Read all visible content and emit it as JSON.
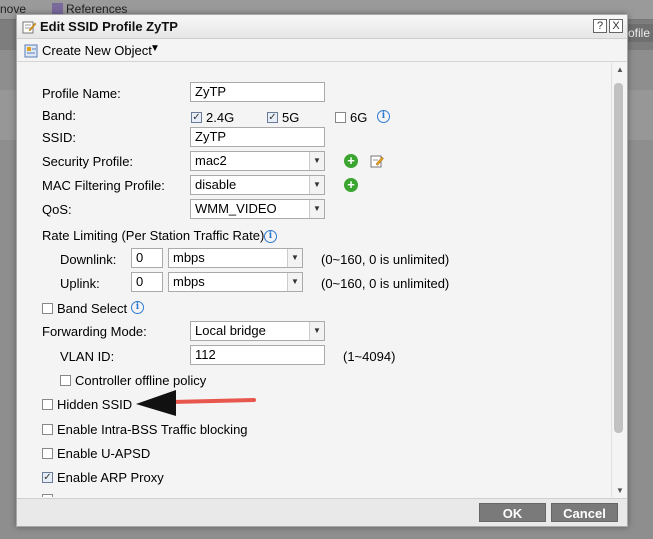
{
  "background": {
    "top_left_text": "nove",
    "top_menu_references": "References",
    "right_text": "rofile"
  },
  "dialog": {
    "title": "Edit SSID Profile ZyTP",
    "help_button": "?",
    "close_button": "X",
    "toolbar": {
      "create_new_object": "Create New Object",
      "caret": "▼"
    },
    "form": {
      "profile_name_label": "Profile Name:",
      "profile_name_value": "ZyTP",
      "band_label": "Band:",
      "band_24_label": "2.4G",
      "band_24_checked": true,
      "band_5_label": "5G",
      "band_5_checked": true,
      "band_6_label": "6G",
      "band_6_checked": false,
      "ssid_label": "SSID:",
      "ssid_value": "ZyTP",
      "security_profile_label": "Security Profile:",
      "security_profile_value": "mac2",
      "mac_filtering_label": "MAC Filtering Profile:",
      "mac_filtering_value": "disable",
      "qos_label": "QoS:",
      "qos_value": "WMM_VIDEO",
      "rate_limiting_label": "Rate Limiting (Per Station Traffic Rate)",
      "downlink_label": "Downlink:",
      "downlink_value": "0",
      "downlink_unit": "mbps",
      "downlink_range": "(0~160, 0 is unlimited)",
      "uplink_label": "Uplink:",
      "uplink_value": "0",
      "uplink_unit": "mbps",
      "uplink_range": "(0~160, 0 is unlimited)",
      "band_select_label": "Band Select",
      "band_select_checked": false,
      "forwarding_mode_label": "Forwarding Mode:",
      "forwarding_mode_value": "Local bridge",
      "vlan_id_label": "VLAN ID:",
      "vlan_id_value": "112",
      "vlan_id_range": "(1~4094)",
      "controller_offline_label": "Controller offline policy",
      "controller_offline_checked": false,
      "hidden_ssid_label": "Hidden SSID",
      "hidden_ssid_checked": false,
      "intra_bss_label": "Enable Intra-BSS Traffic blocking",
      "intra_bss_checked": false,
      "u_apsd_label": "Enable U-APSD",
      "u_apsd_checked": false,
      "arp_proxy_label": "Enable ARP Proxy",
      "arp_proxy_checked": true
    },
    "buttons": {
      "ok": "OK",
      "cancel": "Cancel"
    }
  },
  "annotation": {
    "arrow_color": "#e8574d",
    "points_to": "Hidden SSID"
  },
  "colors": {
    "add_icon": "#3aa52f",
    "info_icon": "#2e7ad1",
    "button_bg": "#7a7a7a"
  }
}
